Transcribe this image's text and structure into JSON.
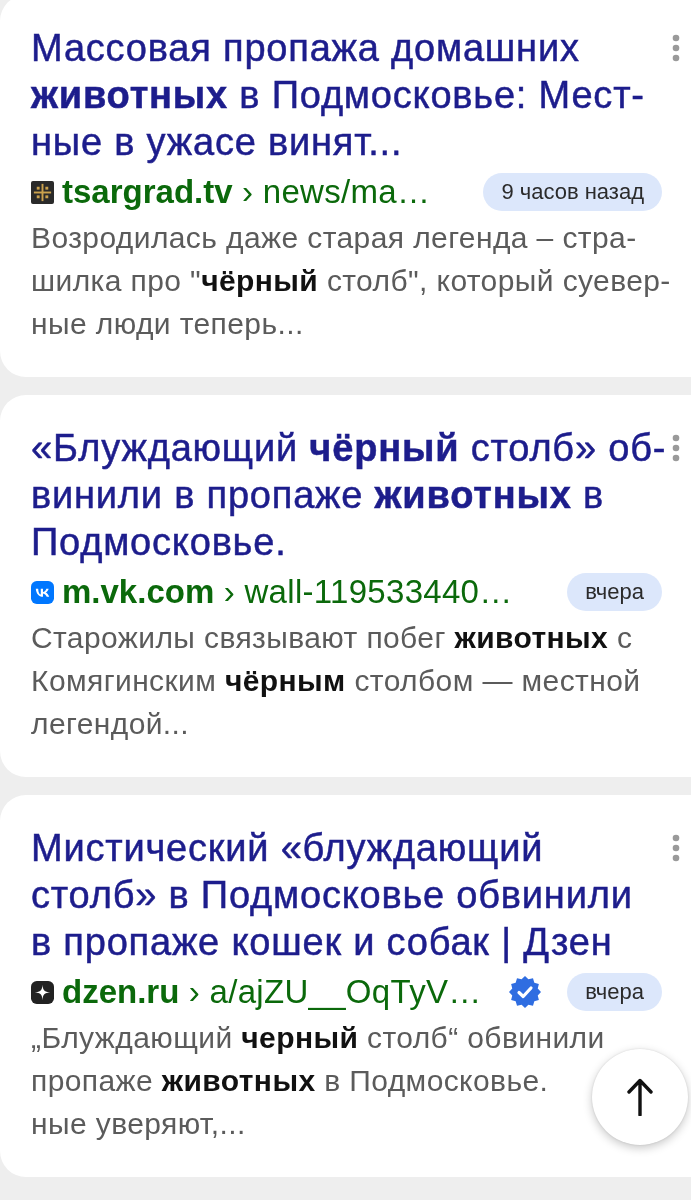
{
  "results": [
    {
      "title": [
        "Массовая пропажа домашних",
        "**животных** в Подмосковье: Мест-",
        "ные в ужасе винят..."
      ],
      "source": {
        "kind": "cross",
        "url": "**tsargrad.tv** › news/ma…",
        "verified": false
      },
      "time": "9 часов назад",
      "snippet": [
        "Возродилась даже старая легенда – стра-",
        "шилка про \"**чёрный** столб\", который суевер-",
        "ные люди теперь..."
      ]
    },
    {
      "title": [
        "«Блуждающий **чёрный** столб» об-",
        "винили в пропаже **животных** в",
        "Подмосковье."
      ],
      "source": {
        "kind": "wordmark",
        "url": "**m.vk.com** › wall-119533440…",
        "verified": false
      },
      "time": "вчера",
      "snippet": [
        "Старожилы связывают побег **животных** с",
        "Комягинским **чёрным** столбом — местной",
        "легендой..."
      ]
    },
    {
      "title": [
        "Мистический «блуждающий",
        "столб» в Подмосковье обвинили",
        "в пропаже кошек и собак | Дзен"
      ],
      "source": {
        "kind": "sparkle",
        "url": "**dzen.ru** › a/ajZU__OqTyV…",
        "verified": true
      },
      "time": "вчера",
      "snippet": [
        "„Блуждающий **черный** столб“ обвинили",
        "пропаже **животных** в Подмосковье.",
        "ные уверяют,..."
      ]
    }
  ]
}
